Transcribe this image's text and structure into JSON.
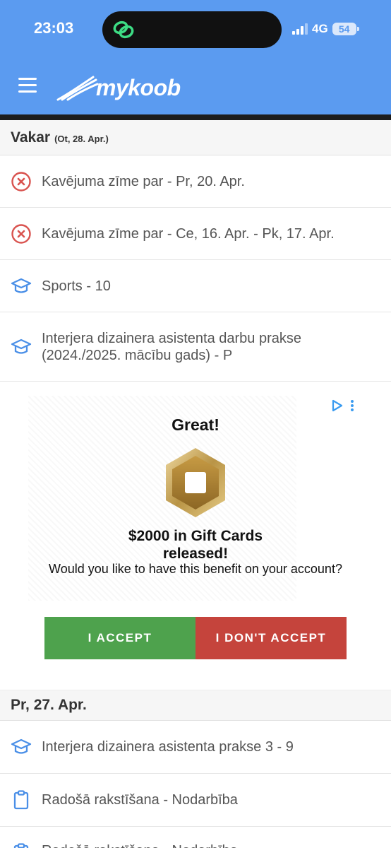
{
  "status_bar": {
    "time": "23:03",
    "network": "4G",
    "battery": "54"
  },
  "app": {
    "logo_text": "mykoob",
    "accent": "#5b9bf0"
  },
  "sections": [
    {
      "title": "Vakar",
      "subtitle": "(Ot, 28. Apr.)",
      "items": [
        {
          "icon": "absence-x-icon",
          "text": "Kavējuma zīme par - Pr, 20. Apr."
        },
        {
          "icon": "absence-x-icon",
          "text": "Kavējuma zīme par - Ce, 16. Apr. - Pk, 17. Apr."
        },
        {
          "icon": "graduation-cap-icon",
          "text": "Sports - 10"
        },
        {
          "icon": "graduation-cap-icon",
          "text": "Interjera dizainera asistenta darbu prakse (2024./2025. mācību gads) - P"
        }
      ]
    },
    {
      "title": "Pr, 27. Apr.",
      "items": [
        {
          "icon": "graduation-cap-icon",
          "text": "Interjera dizainera asistenta prakse 3 - 9"
        },
        {
          "icon": "clipboard-icon",
          "text": "Radošā rakstīšana - Nodarbība"
        },
        {
          "icon": "clipboard-icon",
          "text": "Radošā rakstīšana - Nodarbība"
        }
      ]
    }
  ],
  "ad": {
    "title": "Great!",
    "headline": "$2000 in Gift Cards released!",
    "question": "Would you like to have this benefit on your account?",
    "accept_label": "I ACCEPT",
    "decline_label": "I DON'T ACCEPT",
    "accept_color": "#4ea24d",
    "decline_color": "#c5443c"
  }
}
